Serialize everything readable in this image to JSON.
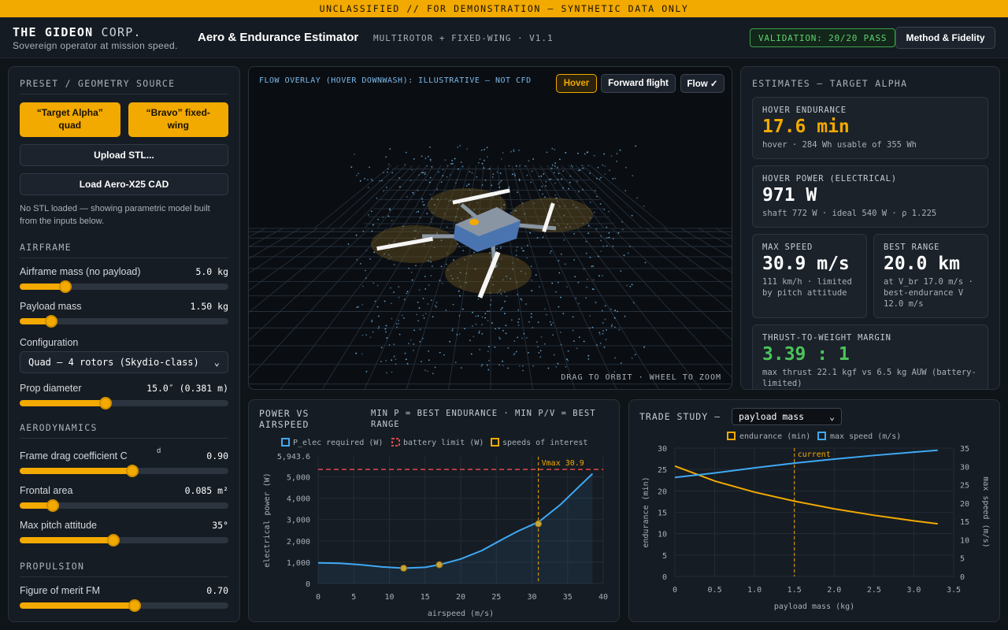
{
  "banner": "UNCLASSIFIED // FOR DEMONSTRATION — SYNTHETIC DATA ONLY",
  "header": {
    "brand_bold": "THE GIDEON",
    "brand_thin": "CORP.",
    "brand_sub": "Sovereign operator at mission speed.",
    "app_title": "Aero & Endurance Estimator",
    "app_sub": "MULTIROTOR + FIXED-WING · V1.1",
    "validation": "VALIDATION: 20/20 PASS",
    "method_button": "Method & Fidelity"
  },
  "left": {
    "preset_heading": "PRESET / GEOMETRY SOURCE",
    "preset_alpha": "“Target Alpha” quad",
    "preset_bravo": "“Bravo” fixed-wing",
    "upload_stl": "Upload STL...",
    "load_cad": "Load Aero-X25 CAD",
    "note": "No STL loaded — showing parametric model built from the inputs below.",
    "airframe_heading": "AIRFRAME",
    "airframe_mass": {
      "label": "Airframe mass (no payload)",
      "value": "5.0 kg",
      "level": 0.22
    },
    "payload_mass": {
      "label": "Payload mass",
      "value": "1.50 kg",
      "level": 0.15
    },
    "config_label": "Configuration",
    "config_value": "Quad — 4 rotors (Skydio-class)",
    "prop_diameter": {
      "label": "Prop diameter",
      "value": "15.0″ (0.381 m)",
      "level": 0.41
    },
    "aero_heading": "AERODYNAMICS",
    "drag_coef": {
      "label": "Frame drag coefficient C",
      "sub": "d",
      "value": "0.90",
      "level": 0.54
    },
    "frontal_area": {
      "label": "Frontal area",
      "value": "0.085 m²",
      "level": 0.16
    },
    "max_pitch": {
      "label": "Max pitch attitude",
      "value": "35°",
      "level": 0.45
    },
    "prop_heading": "PROPULSION",
    "fom": {
      "label": "Figure of merit FM",
      "value": "0.70",
      "level": 0.55
    }
  },
  "viewport": {
    "caption": "FLOW OVERLAY (HOVER DOWNWASH): ILLUSTRATIVE — NOT CFD",
    "btn_hover": "Hover",
    "btn_forward": "Forward flight",
    "btn_flow": "Flow ✓",
    "hint": "DRAG TO ORBIT · WHEEL TO ZOOM"
  },
  "estimates": {
    "heading": "ESTIMATES — TARGET ALPHA",
    "hover_endurance": {
      "label": "HOVER ENDURANCE",
      "value": "17.6 min",
      "sub": "hover · 284 Wh usable of 355 Wh"
    },
    "hover_power": {
      "label": "HOVER POWER (ELECTRICAL)",
      "value": "971 W",
      "sub": "shaft 772 W · ideal 540 W · ρ 1.225"
    },
    "max_speed": {
      "label": "MAX SPEED",
      "value": "30.9 m/s",
      "sub": "111 km/h · limited by pitch attitude"
    },
    "best_range": {
      "label": "BEST RANGE",
      "value": "20.0 km",
      "sub": "at V_br 17.0 m/s · best-endurance V 12.0 m/s"
    },
    "twr": {
      "label": "THRUST-TO-WEIGHT MARGIN",
      "value": "3.39 : 1",
      "sub": "max thrust 22.1 kgf vs 6.5 kg AUW (battery-limited)"
    }
  },
  "colors": {
    "accent": "#f2a900",
    "blue": "#3fa9f5",
    "green": "#4cc35a",
    "danger": "#e04848"
  },
  "power_chart": {
    "title": "POWER VS AIRSPEED",
    "subtitle": "MIN P = BEST ENDURANCE · MIN P/V = BEST RANGE",
    "legend": [
      "P_elec required (W)",
      "battery limit (W)",
      "speeds of interest"
    ],
    "vmax_label": "Vmax 30.9"
  },
  "trade_chart": {
    "title": "TRADE STUDY —",
    "select": "payload mass",
    "legend": [
      "endurance (min)",
      "max speed (m/s)"
    ],
    "current_label": "current"
  },
  "chart_data": [
    {
      "type": "line",
      "title": "POWER VS AIRSPEED",
      "xlabel": "airspeed (m/s)",
      "ylabel": "electrical power (W)",
      "xlim": [
        0,
        40
      ],
      "ylim": [
        0,
        5943.6
      ],
      "xticks": [
        0,
        5,
        10,
        15,
        20,
        25,
        30,
        35,
        40
      ],
      "yticks": [
        0,
        1000,
        2000,
        3000,
        4000,
        5000
      ],
      "ytick_labels": [
        "0",
        "1,000",
        "2,000",
        "3,000",
        "4,000",
        "5,000"
      ],
      "ymax_label": "5,943.6",
      "series": [
        {
          "name": "P_elec required (W)",
          "x": [
            0,
            3,
            6,
            9,
            12,
            15,
            17,
            20,
            23,
            26,
            28,
            31,
            34,
            36,
            38.5
          ],
          "y": [
            971,
            950,
            880,
            780,
            720,
            760,
            880,
            1150,
            1550,
            2100,
            2450,
            2900,
            3700,
            4350,
            5150
          ]
        },
        {
          "name": "battery limit (W)",
          "y": 5350
        }
      ],
      "points": [
        {
          "x": 12.0,
          "y": 720
        },
        {
          "x": 17.0,
          "y": 880
        },
        {
          "x": 30.9,
          "y": 2800
        }
      ],
      "vline": 30.9
    },
    {
      "type": "line",
      "title": "TRADE STUDY — payload mass",
      "xlabel": "payload mass (kg)",
      "ylabel": "endurance (min)",
      "y2label": "max speed (m/s)",
      "xlim": [
        0,
        3.5
      ],
      "ylim": [
        0,
        30
      ],
      "y2lim": [
        0,
        35
      ],
      "xticks": [
        0,
        0.5,
        1.0,
        1.5,
        2.0,
        2.5,
        3.0,
        3.5
      ],
      "xtick_labels": [
        "0",
        "0.5",
        "1.0",
        "1.5",
        "2.0",
        "2.5",
        "3.0",
        "3.5"
      ],
      "yticks": [
        0,
        5,
        10,
        15,
        20,
        25,
        30
      ],
      "y2ticks": [
        0,
        5,
        10,
        15,
        20,
        25,
        30,
        35
      ],
      "series": [
        {
          "name": "endurance (min)",
          "x": [
            0,
            0.5,
            1.0,
            1.5,
            2.0,
            2.5,
            3.0,
            3.3
          ],
          "y": [
            25.8,
            22.3,
            19.7,
            17.6,
            15.8,
            14.3,
            13.0,
            12.3
          ]
        },
        {
          "name": "max speed (m/s)",
          "x": [
            0,
            0.5,
            1.0,
            1.5,
            2.0,
            2.5,
            3.0,
            3.3
          ],
          "y": [
            27.0,
            28.2,
            29.6,
            30.9,
            32.0,
            33.0,
            33.9,
            34.4
          ]
        }
      ],
      "vline": 1.5
    }
  ]
}
